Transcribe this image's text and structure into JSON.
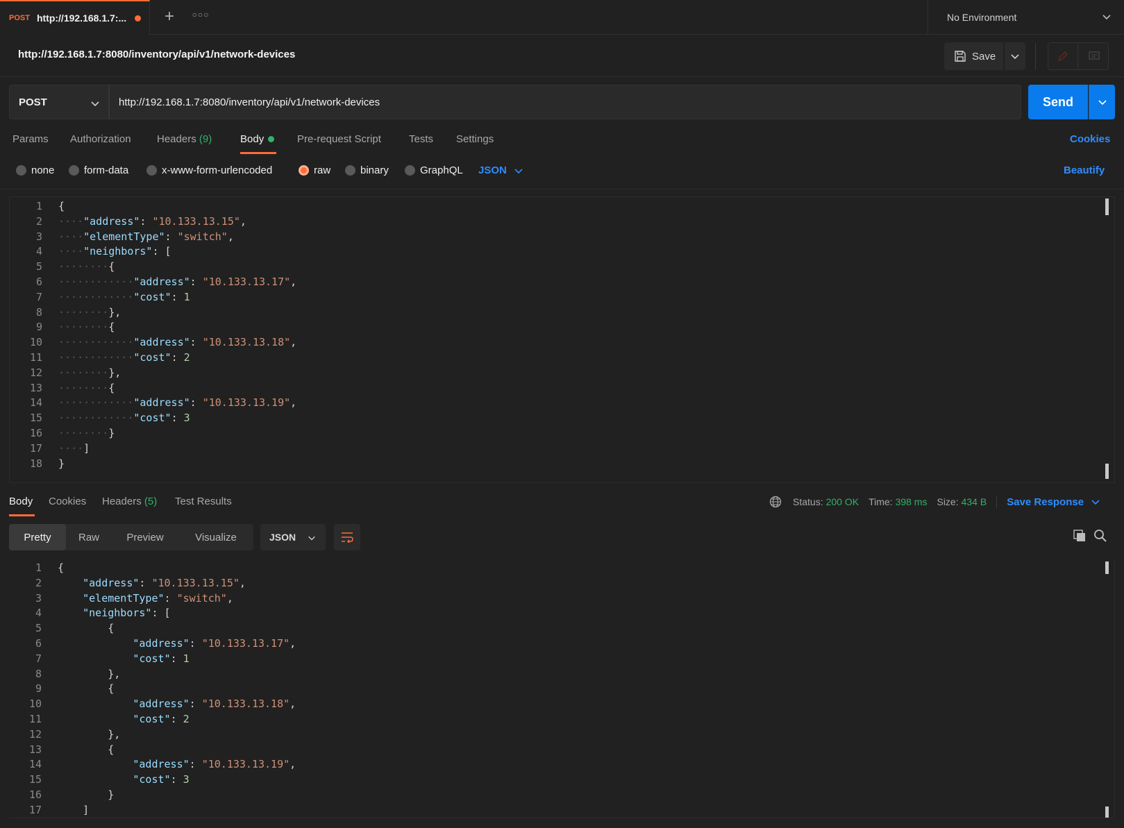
{
  "tab": {
    "method": "POST",
    "title": "http://192.168.1.7:..."
  },
  "environment": {
    "label": "No Environment"
  },
  "request": {
    "title": "http://192.168.1.7:8080/inventory/api/v1/network-devices",
    "save_label": "Save",
    "method": "POST",
    "url": "http://192.168.1.7:8080/inventory/api/v1/network-devices",
    "send_label": "Send"
  },
  "request_tabs": {
    "params": "Params",
    "authorization": "Authorization",
    "headers": "Headers",
    "headers_count": "(9)",
    "body": "Body",
    "prerequest": "Pre-request Script",
    "tests": "Tests",
    "settings": "Settings",
    "cookies": "Cookies"
  },
  "body_types": {
    "none": "none",
    "form_data": "form-data",
    "urlencoded": "x-www-form-urlencoded",
    "raw": "raw",
    "binary": "binary",
    "graphql": "GraphQL",
    "format": "JSON",
    "beautify": "Beautify",
    "selected": "raw"
  },
  "request_body_lines": [
    {
      "n": "1",
      "t": [
        [
          "p",
          "{"
        ]
      ]
    },
    {
      "n": "2",
      "t": [
        [
          "ws",
          "····"
        ],
        [
          "k",
          "\"address\""
        ],
        [
          "p",
          ": "
        ],
        [
          "s",
          "\"10.133.13.15\""
        ],
        [
          "p",
          ","
        ]
      ]
    },
    {
      "n": "3",
      "t": [
        [
          "ws",
          "····"
        ],
        [
          "k",
          "\"elementType\""
        ],
        [
          "p",
          ": "
        ],
        [
          "s",
          "\"switch\""
        ],
        [
          "p",
          ","
        ]
      ]
    },
    {
      "n": "4",
      "t": [
        [
          "ws",
          "····"
        ],
        [
          "k",
          "\"neighbors\""
        ],
        [
          "p",
          ": ["
        ]
      ]
    },
    {
      "n": "5",
      "t": [
        [
          "ws",
          "········"
        ],
        [
          "p",
          "{"
        ]
      ]
    },
    {
      "n": "6",
      "t": [
        [
          "ws",
          "············"
        ],
        [
          "k",
          "\"address\""
        ],
        [
          "p",
          ": "
        ],
        [
          "s",
          "\"10.133.13.17\""
        ],
        [
          "p",
          ","
        ]
      ]
    },
    {
      "n": "7",
      "t": [
        [
          "ws",
          "············"
        ],
        [
          "k",
          "\"cost\""
        ],
        [
          "p",
          ": "
        ],
        [
          "n",
          "1"
        ]
      ]
    },
    {
      "n": "8",
      "t": [
        [
          "ws",
          "········"
        ],
        [
          "p",
          "},"
        ]
      ]
    },
    {
      "n": "9",
      "t": [
        [
          "ws",
          "········"
        ],
        [
          "p",
          "{"
        ]
      ]
    },
    {
      "n": "10",
      "t": [
        [
          "ws",
          "············"
        ],
        [
          "k",
          "\"address\""
        ],
        [
          "p",
          ": "
        ],
        [
          "s",
          "\"10.133.13.18\""
        ],
        [
          "p",
          ","
        ]
      ]
    },
    {
      "n": "11",
      "t": [
        [
          "ws",
          "············"
        ],
        [
          "k",
          "\"cost\""
        ],
        [
          "p",
          ": "
        ],
        [
          "n",
          "2"
        ]
      ]
    },
    {
      "n": "12",
      "t": [
        [
          "ws",
          "········"
        ],
        [
          "p",
          "},"
        ]
      ]
    },
    {
      "n": "13",
      "t": [
        [
          "ws",
          "········"
        ],
        [
          "p",
          "{"
        ]
      ]
    },
    {
      "n": "14",
      "t": [
        [
          "ws",
          "············"
        ],
        [
          "k",
          "\"address\""
        ],
        [
          "p",
          ": "
        ],
        [
          "s",
          "\"10.133.13.19\""
        ],
        [
          "p",
          ","
        ]
      ]
    },
    {
      "n": "15",
      "t": [
        [
          "ws",
          "············"
        ],
        [
          "k",
          "\"cost\""
        ],
        [
          "p",
          ": "
        ],
        [
          "n",
          "3"
        ]
      ]
    },
    {
      "n": "16",
      "t": [
        [
          "ws",
          "········"
        ],
        [
          "p",
          "}"
        ]
      ]
    },
    {
      "n": "17",
      "t": [
        [
          "ws",
          "····"
        ],
        [
          "p",
          "]"
        ]
      ]
    },
    {
      "n": "18",
      "t": [
        [
          "p",
          "}"
        ]
      ]
    }
  ],
  "response_tabs": {
    "body": "Body",
    "cookies": "Cookies",
    "headers": "Headers",
    "headers_count": "(5)",
    "test_results": "Test Results"
  },
  "response_status": {
    "status_label": "Status:",
    "status": "200 OK",
    "time_label": "Time:",
    "time": "398 ms",
    "size_label": "Size:",
    "size": "434 B",
    "save_response": "Save Response"
  },
  "response_view": {
    "pretty": "Pretty",
    "raw": "Raw",
    "preview": "Preview",
    "visualize": "Visualize",
    "format": "JSON"
  },
  "response_body_lines": [
    {
      "n": "1",
      "t": [
        [
          "p",
          "{"
        ]
      ]
    },
    {
      "n": "2",
      "t": [
        [
          "ws",
          "    "
        ],
        [
          "k",
          "\"address\""
        ],
        [
          "p",
          ": "
        ],
        [
          "s",
          "\"10.133.13.15\""
        ],
        [
          "p",
          ","
        ]
      ]
    },
    {
      "n": "3",
      "t": [
        [
          "ws",
          "    "
        ],
        [
          "k",
          "\"elementType\""
        ],
        [
          "p",
          ": "
        ],
        [
          "s",
          "\"switch\""
        ],
        [
          "p",
          ","
        ]
      ]
    },
    {
      "n": "4",
      "t": [
        [
          "ws",
          "    "
        ],
        [
          "k",
          "\"neighbors\""
        ],
        [
          "p",
          ": ["
        ]
      ]
    },
    {
      "n": "5",
      "t": [
        [
          "ws",
          "        "
        ],
        [
          "p",
          "{"
        ]
      ]
    },
    {
      "n": "6",
      "t": [
        [
          "ws",
          "            "
        ],
        [
          "k",
          "\"address\""
        ],
        [
          "p",
          ": "
        ],
        [
          "s",
          "\"10.133.13.17\""
        ],
        [
          "p",
          ","
        ]
      ]
    },
    {
      "n": "7",
      "t": [
        [
          "ws",
          "            "
        ],
        [
          "k",
          "\"cost\""
        ],
        [
          "p",
          ": "
        ],
        [
          "n",
          "1"
        ]
      ]
    },
    {
      "n": "8",
      "t": [
        [
          "ws",
          "        "
        ],
        [
          "p",
          "},"
        ]
      ]
    },
    {
      "n": "9",
      "t": [
        [
          "ws",
          "        "
        ],
        [
          "p",
          "{"
        ]
      ]
    },
    {
      "n": "10",
      "t": [
        [
          "ws",
          "            "
        ],
        [
          "k",
          "\"address\""
        ],
        [
          "p",
          ": "
        ],
        [
          "s",
          "\"10.133.13.18\""
        ],
        [
          "p",
          ","
        ]
      ]
    },
    {
      "n": "11",
      "t": [
        [
          "ws",
          "            "
        ],
        [
          "k",
          "\"cost\""
        ],
        [
          "p",
          ": "
        ],
        [
          "n",
          "2"
        ]
      ]
    },
    {
      "n": "12",
      "t": [
        [
          "ws",
          "        "
        ],
        [
          "p",
          "},"
        ]
      ]
    },
    {
      "n": "13",
      "t": [
        [
          "ws",
          "        "
        ],
        [
          "p",
          "{"
        ]
      ]
    },
    {
      "n": "14",
      "t": [
        [
          "ws",
          "            "
        ],
        [
          "k",
          "\"address\""
        ],
        [
          "p",
          ": "
        ],
        [
          "s",
          "\"10.133.13.19\""
        ],
        [
          "p",
          ","
        ]
      ]
    },
    {
      "n": "15",
      "t": [
        [
          "ws",
          "            "
        ],
        [
          "k",
          "\"cost\""
        ],
        [
          "p",
          ": "
        ],
        [
          "n",
          "3"
        ]
      ]
    },
    {
      "n": "16",
      "t": [
        [
          "ws",
          "        "
        ],
        [
          "p",
          "}"
        ]
      ]
    },
    {
      "n": "17",
      "t": [
        [
          "ws",
          "    "
        ],
        [
          "p",
          "]"
        ]
      ]
    }
  ],
  "colors": {
    "accent": "#ff6c37",
    "primary": "#097bed",
    "link": "#2f8dff",
    "success": "#2fb36a",
    "background": "#212121"
  },
  "icons": [
    "plus-icon",
    "more-icon",
    "chevron-down-icon",
    "save-icon",
    "edit-icon",
    "comment-icon",
    "globe-icon",
    "wrap-icon",
    "copy-icon",
    "search-icon"
  ]
}
